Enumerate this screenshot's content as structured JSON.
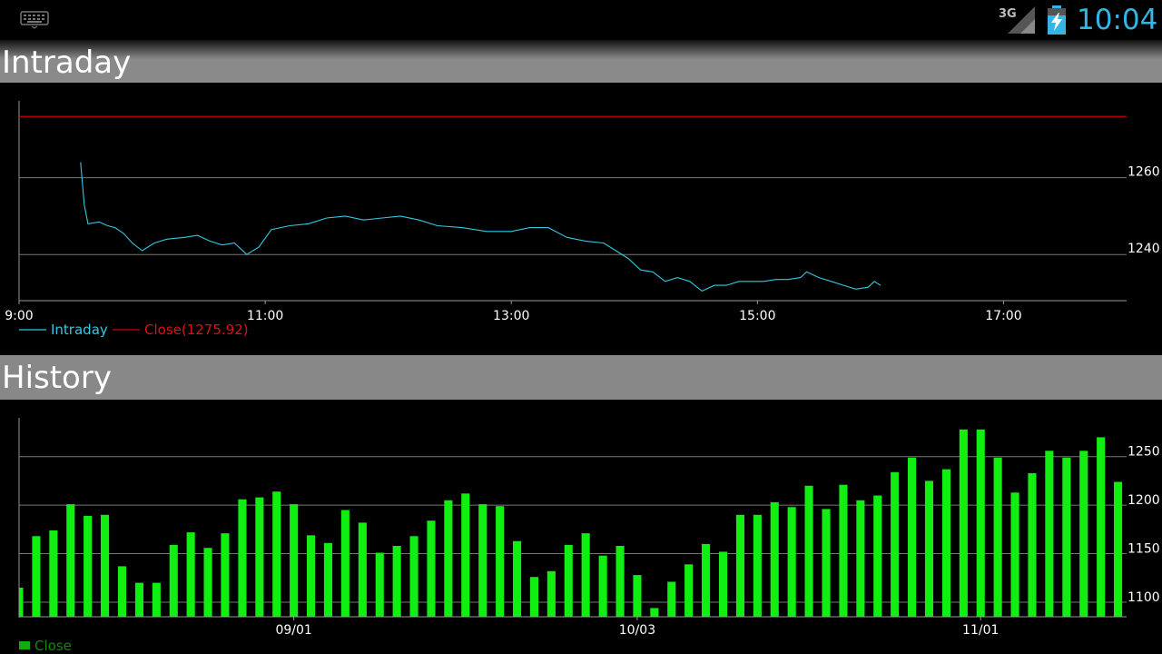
{
  "status_bar": {
    "network": "3G",
    "time": "10:04",
    "accent_color": "#33b5e5"
  },
  "intraday": {
    "title": "Intraday",
    "legend": {
      "series_label": "Intraday",
      "close_label": "Close(1275.92)"
    }
  },
  "history": {
    "title": "History",
    "legend": {
      "series_label": "Close"
    }
  },
  "chart_data": [
    {
      "type": "line",
      "title": "Intraday",
      "x_unit": "time of day (hours)",
      "xlim": [
        9,
        18
      ],
      "ylim": [
        1228,
        1280
      ],
      "x_ticks": [
        9,
        11,
        13,
        15,
        17
      ],
      "x_tick_labels": [
        "9:00",
        "11:00",
        "13:00",
        "15:00",
        "17:00"
      ],
      "y_ticks": [
        1240,
        1260
      ],
      "y_tick_labels": [
        "1240",
        "1260"
      ],
      "grid": true,
      "legend_position": "bottom-left",
      "series": [
        {
          "name": "Intraday",
          "color": "#33c9e0",
          "points": [
            [
              9.5,
              1264
            ],
            [
              9.53,
              1253
            ],
            [
              9.56,
              1248
            ],
            [
              9.65,
              1248.5
            ],
            [
              9.72,
              1247.5
            ],
            [
              9.78,
              1247
            ],
            [
              9.85,
              1245.5
            ],
            [
              9.92,
              1243
            ],
            [
              10.0,
              1241
            ],
            [
              10.1,
              1243
            ],
            [
              10.2,
              1244
            ],
            [
              10.35,
              1244.5
            ],
            [
              10.45,
              1245
            ],
            [
              10.55,
              1243.5
            ],
            [
              10.65,
              1242.5
            ],
            [
              10.75,
              1243
            ],
            [
              10.85,
              1240
            ],
            [
              10.95,
              1242
            ],
            [
              11.05,
              1246.5
            ],
            [
              11.2,
              1247.5
            ],
            [
              11.35,
              1248
            ],
            [
              11.5,
              1249.5
            ],
            [
              11.65,
              1250
            ],
            [
              11.8,
              1249
            ],
            [
              11.95,
              1249.5
            ],
            [
              12.1,
              1250
            ],
            [
              12.25,
              1249
            ],
            [
              12.4,
              1247.5
            ],
            [
              12.6,
              1247
            ],
            [
              12.8,
              1246
            ],
            [
              13.0,
              1246
            ],
            [
              13.15,
              1247
            ],
            [
              13.3,
              1247
            ],
            [
              13.45,
              1244.5
            ],
            [
              13.6,
              1243.5
            ],
            [
              13.75,
              1243
            ],
            [
              13.85,
              1241
            ],
            [
              13.95,
              1239
            ],
            [
              14.05,
              1236
            ],
            [
              14.15,
              1235.5
            ],
            [
              14.25,
              1233
            ],
            [
              14.35,
              1234
            ],
            [
              14.45,
              1233
            ],
            [
              14.55,
              1230.5
            ],
            [
              14.65,
              1232
            ],
            [
              14.75,
              1232
            ],
            [
              14.85,
              1233
            ],
            [
              14.95,
              1233
            ],
            [
              15.05,
              1233
            ],
            [
              15.15,
              1233.5
            ],
            [
              15.25,
              1233.5
            ],
            [
              15.35,
              1234
            ],
            [
              15.4,
              1235.5
            ],
            [
              15.5,
              1234
            ],
            [
              15.6,
              1233
            ],
            [
              15.7,
              1232
            ],
            [
              15.8,
              1231
            ],
            [
              15.9,
              1231.5
            ],
            [
              15.95,
              1233
            ],
            [
              16.0,
              1232
            ]
          ]
        },
        {
          "name": "Close(1275.92)",
          "color": "#cc0000",
          "value": 1275.92
        }
      ]
    },
    {
      "type": "bar",
      "title": "History",
      "ylim": [
        1085,
        1290
      ],
      "y_ticks": [
        1100,
        1150,
        1200,
        1250
      ],
      "y_tick_labels": [
        "1100",
        "1150",
        "1200",
        "1250"
      ],
      "x_tick_labels": [
        "09/01",
        "10/03",
        "11/01"
      ],
      "x_tick_bar_index": [
        16,
        36,
        56
      ],
      "grid": true,
      "legend_position": "bottom-left",
      "series": [
        {
          "name": "Close",
          "color": "#11ee11",
          "values": [
            1115,
            1168,
            1174,
            1201,
            1189,
            1190,
            1137,
            1120,
            1120,
            1159,
            1172,
            1156,
            1171,
            1206,
            1208,
            1214,
            1201,
            1169,
            1161,
            1195,
            1182,
            1151,
            1158,
            1168,
            1184,
            1205,
            1212,
            1201,
            1199,
            1163,
            1126,
            1132,
            1159,
            1171,
            1148,
            1158,
            1128,
            1094,
            1121,
            1139,
            1160,
            1152,
            1190,
            1190,
            1203,
            1198,
            1220,
            1196,
            1221,
            1205,
            1210,
            1234,
            1249,
            1225,
            1237,
            1278,
            1278,
            1249,
            1213,
            1233,
            1256,
            1249,
            1256,
            1270,
            1224
          ]
        }
      ]
    }
  ]
}
